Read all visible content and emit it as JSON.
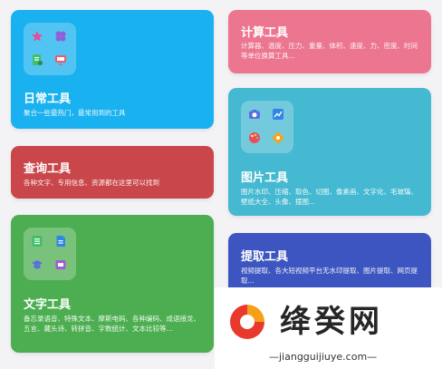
{
  "cards": {
    "daily": {
      "title": "日常工具",
      "desc": "聚合一些最热门，最常用到的工具"
    },
    "calc": {
      "title": "计算工具",
      "desc": "计算器、温度、压力、重量、体积、速度、力、密度、时间等单位换算工具..."
    },
    "query": {
      "title": "查询工具",
      "desc": "各种文字、专用信息、资源都在这里可以找到"
    },
    "image": {
      "title": "图片工具",
      "desc": "图片水印、压缩、取色、切图、像素画、文字化、毛玻璃、壁纸大全、头像、摆图..."
    },
    "text": {
      "title": "文字工具",
      "desc": "备忘录语音、特殊文本、摩斯电码、各种编码、成语接龙、五言、藏头诗、转拼音、字数统计、文本比较等..."
    },
    "extract": {
      "title": "提取工具",
      "desc": "视频提取、各大短视频平台无水印提取、图片提取、网页提取..."
    }
  },
  "icons": {
    "daily": [
      "star-icon",
      "clover-icon",
      "document-icon",
      "monitor-icon"
    ],
    "image": [
      "camera-icon",
      "chart-icon",
      "palette-icon",
      "flower-icon"
    ],
    "text": [
      "list-icon",
      "file-icon",
      "graduation-icon",
      "cube-icon"
    ]
  },
  "watermark": {
    "brand": "绛癸网",
    "url": "—jiangguijiuye.com—"
  },
  "colors": {
    "daily": "#19b1ef",
    "calc": "#ec7590",
    "query": "#c9474b",
    "image": "#44b9d1",
    "text": "#4cae50",
    "extract": "#3c55c0"
  }
}
